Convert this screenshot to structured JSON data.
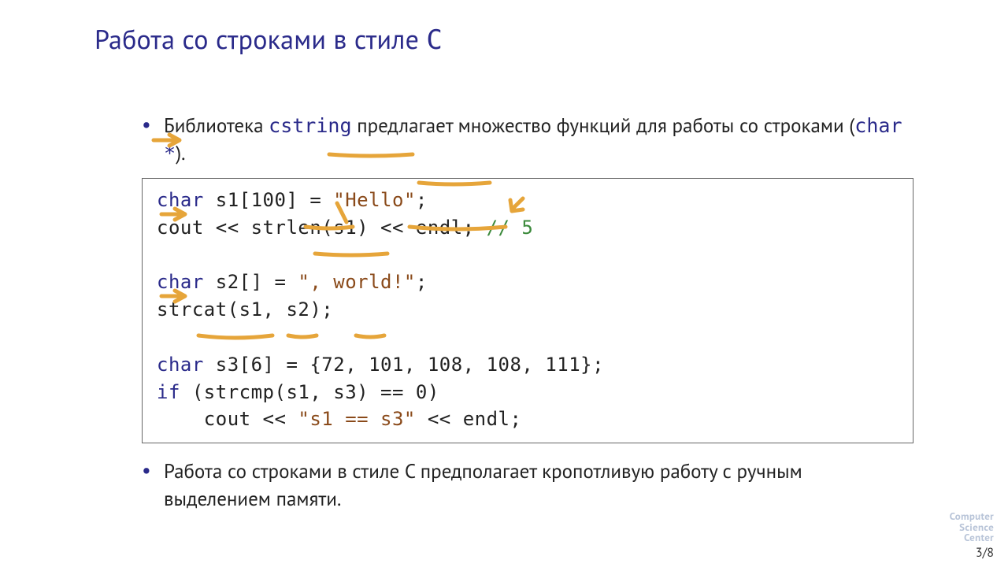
{
  "title_prefix": "Работа со строками в стиле ",
  "title_suffix": "C",
  "bullet1_a": "Библиотека ",
  "bullet1_code1": "cstring",
  "bullet1_b": " предлагает множество функций для работы со строками (",
  "bullet1_code2": "char *",
  "bullet1_c": ").",
  "bullet2": "Работа со строками в стиле C предполагает кропотливую работу с ручным выделением памяти.",
  "code": {
    "l1a": "char",
    "l1b": " s1[100] = ",
    "l1c": "\"Hello\"",
    "l1d": ";",
    "l2a": "cout << strlen(s1) << endl; ",
    "l2b": "// 5",
    "blank1": "",
    "l3a": "char",
    "l3b": " s2[] = ",
    "l3c": "\", world!\"",
    "l3d": ";",
    "l4": "strcat(s1, s2);",
    "blank2": "",
    "l5a": "char",
    "l5b": " s3[6] = {72, 101, 108, 108, 111};",
    "l6a": "if",
    "l6b": " (strcmp(s1, s3) == 0)",
    "l7a": "    cout << ",
    "l7b": "\"s1 == s3\"",
    "l7c": " << endl;"
  },
  "logo_l1": "Computer",
  "logo_l2": "Science",
  "logo_l3": "Center",
  "page": "3/8"
}
